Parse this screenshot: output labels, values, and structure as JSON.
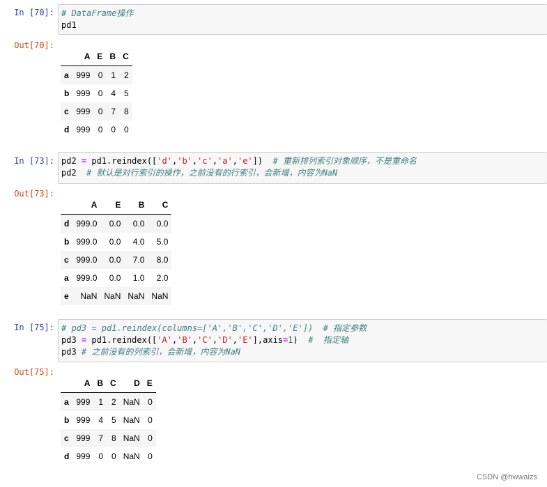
{
  "cells": [
    {
      "in_prompt": "In  [70]:",
      "out_prompt": "Out[70]:",
      "code_lines": [
        [
          {
            "t": "# DataFrame操作",
            "c": "cmt"
          }
        ],
        [
          {
            "t": "pd1",
            "c": ""
          }
        ]
      ],
      "table": {
        "columns": [
          "",
          "A",
          "E",
          "B",
          "C"
        ],
        "rows": [
          [
            "a",
            "999",
            "0",
            "1",
            "2"
          ],
          [
            "b",
            "999",
            "0",
            "4",
            "5"
          ],
          [
            "c",
            "999",
            "0",
            "7",
            "8"
          ],
          [
            "d",
            "999",
            "0",
            "0",
            "0"
          ]
        ]
      }
    },
    {
      "in_prompt": "In  [73]:",
      "out_prompt": "Out[73]:",
      "code_lines": [
        [
          {
            "t": "pd2 ",
            "c": ""
          },
          {
            "t": "=",
            "c": "op"
          },
          {
            "t": " pd1.reindex([",
            "c": ""
          },
          {
            "t": "'d'",
            "c": "str"
          },
          {
            "t": ",",
            "c": ""
          },
          {
            "t": "'b'",
            "c": "str"
          },
          {
            "t": ",",
            "c": ""
          },
          {
            "t": "'c'",
            "c": "str"
          },
          {
            "t": ",",
            "c": ""
          },
          {
            "t": "'a'",
            "c": "str"
          },
          {
            "t": ",",
            "c": ""
          },
          {
            "t": "'e'",
            "c": "str"
          },
          {
            "t": "])  ",
            "c": ""
          },
          {
            "t": "# 重新排列索引对象顺序，不是重命名",
            "c": "cmt"
          }
        ],
        [
          {
            "t": "pd2  ",
            "c": ""
          },
          {
            "t": "# 默认是对行索引的操作，之前没有的行索引，会新增，内容为NaN",
            "c": "cmt"
          }
        ]
      ],
      "table": {
        "columns": [
          "",
          "A",
          "E",
          "B",
          "C"
        ],
        "rows": [
          [
            "d",
            "999.0",
            "0.0",
            "0.0",
            "0.0"
          ],
          [
            "b",
            "999.0",
            "0.0",
            "4.0",
            "5.0"
          ],
          [
            "c",
            "999.0",
            "0.0",
            "7.0",
            "8.0"
          ],
          [
            "a",
            "999.0",
            "0.0",
            "1.0",
            "2.0"
          ],
          [
            "e",
            "NaN",
            "NaN",
            "NaN",
            "NaN"
          ]
        ]
      }
    },
    {
      "in_prompt": "In  [75]:",
      "out_prompt": "Out[75]:",
      "code_lines": [
        [
          {
            "t": "# pd3 = pd1.reindex(columns=['A','B','C','D','E'])  # 指定参数",
            "c": "cmt"
          }
        ],
        [
          {
            "t": "pd3 ",
            "c": ""
          },
          {
            "t": "=",
            "c": "op"
          },
          {
            "t": " pd1.reindex([",
            "c": ""
          },
          {
            "t": "'A'",
            "c": "str"
          },
          {
            "t": ",",
            "c": ""
          },
          {
            "t": "'B'",
            "c": "str"
          },
          {
            "t": ",",
            "c": ""
          },
          {
            "t": "'C'",
            "c": "str"
          },
          {
            "t": ",",
            "c": ""
          },
          {
            "t": "'D'",
            "c": "str"
          },
          {
            "t": ",",
            "c": ""
          },
          {
            "t": "'E'",
            "c": "str"
          },
          {
            "t": "],axis",
            "c": ""
          },
          {
            "t": "=",
            "c": "op"
          },
          {
            "t": "1",
            "c": "num"
          },
          {
            "t": ")  ",
            "c": ""
          },
          {
            "t": "#  指定轴",
            "c": "cmt"
          }
        ],
        [
          {
            "t": "pd3 ",
            "c": ""
          },
          {
            "t": "# 之前没有的列索引，会新增，内容为NaN",
            "c": "cmt"
          }
        ]
      ],
      "table": {
        "columns": [
          "",
          "A",
          "B",
          "C",
          "D",
          "E"
        ],
        "rows": [
          [
            "a",
            "999",
            "1",
            "2",
            "NaN",
            "0"
          ],
          [
            "b",
            "999",
            "4",
            "5",
            "NaN",
            "0"
          ],
          [
            "c",
            "999",
            "7",
            "8",
            "NaN",
            "0"
          ],
          [
            "d",
            "999",
            "0",
            "0",
            "NaN",
            "0"
          ]
        ]
      }
    }
  ],
  "watermark": "CSDN @hwwaizs"
}
